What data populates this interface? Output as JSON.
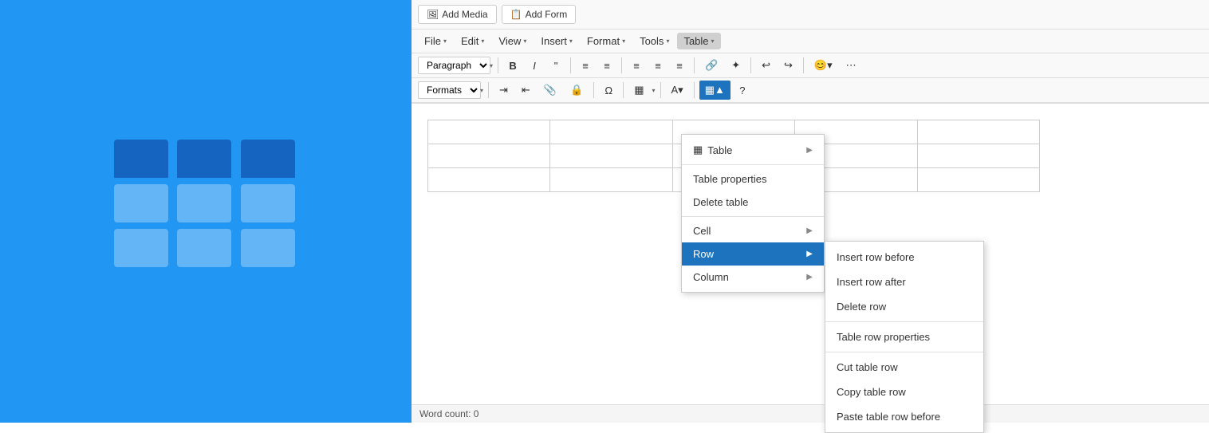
{
  "left_panel": {
    "alt": "Table icon illustration"
  },
  "toolbar_row1": {
    "add_media_label": "Add Media",
    "add_form_label": "Add Form"
  },
  "menubar": {
    "items": [
      {
        "id": "file",
        "label": "File",
        "has_arrow": true
      },
      {
        "id": "edit",
        "label": "Edit",
        "has_arrow": true
      },
      {
        "id": "view",
        "label": "View",
        "has_arrow": true
      },
      {
        "id": "insert",
        "label": "Insert",
        "has_arrow": true
      },
      {
        "id": "format",
        "label": "Format",
        "has_arrow": true
      },
      {
        "id": "tools",
        "label": "Tools",
        "has_arrow": true
      },
      {
        "id": "table",
        "label": "Table",
        "has_arrow": true
      }
    ]
  },
  "formatting_toolbar": {
    "paragraph_select": "Paragraph",
    "buttons": [
      "B",
      "I",
      "\"",
      "≡",
      "≡",
      "≡",
      "≡",
      "🔗",
      "✦",
      "↩",
      "↪"
    ]
  },
  "formatting_toolbar2": {
    "formats_select": "Formats",
    "buttons": [
      "⇥",
      "⇤",
      "📎",
      "🔒",
      "Ω",
      "▦",
      "A",
      "▦"
    ]
  },
  "editor": {
    "table_rows": 3,
    "table_cols": 5
  },
  "context_menu": {
    "table_item": {
      "icon": "🗃",
      "label": "Table",
      "has_arrow": true
    },
    "items": [
      {
        "id": "table-properties",
        "label": "Table properties",
        "has_arrow": false
      },
      {
        "id": "delete-table",
        "label": "Delete table",
        "has_arrow": false
      },
      {
        "id": "separator1",
        "type": "separator"
      },
      {
        "id": "cell",
        "label": "Cell",
        "has_arrow": true
      },
      {
        "id": "row",
        "label": "Row",
        "has_arrow": true,
        "highlighted": true
      },
      {
        "id": "column",
        "label": "Column",
        "has_arrow": true
      }
    ]
  },
  "submenu": {
    "items": [
      {
        "id": "insert-row-before",
        "label": "Insert row before"
      },
      {
        "id": "insert-row-after",
        "label": "Insert row after"
      },
      {
        "id": "delete-row",
        "label": "Delete row"
      },
      {
        "id": "separator1",
        "type": "separator"
      },
      {
        "id": "table-row-properties",
        "label": "Table row properties"
      },
      {
        "id": "separator2",
        "type": "separator"
      },
      {
        "id": "cut-table-row",
        "label": "Cut table row"
      },
      {
        "id": "copy-table-row",
        "label": "Copy table row"
      },
      {
        "id": "paste-table-row-before",
        "label": "Paste table row before"
      }
    ]
  },
  "word_count": {
    "label": "Word count: 0"
  }
}
